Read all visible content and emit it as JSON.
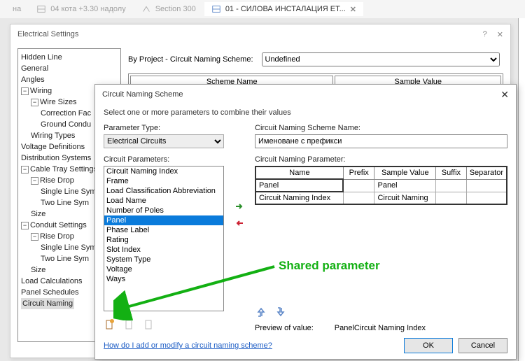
{
  "doc_tabs": {
    "t0_label": "на",
    "t1_label": "04 кота +3.30 надолу",
    "t2_label": "Section 300",
    "t3_label": "01 - СИЛОВА ИНСТАЛАЦИЯ ЕТ..."
  },
  "dlg1": {
    "title": "Electrical Settings",
    "help_glyph": "?",
    "close_glyph": "✕",
    "byproj_label": "By Project - Circuit Naming Scheme:",
    "byproj_value": "Undefined",
    "col_scheme": "Scheme Name",
    "col_sample": "Sample Value",
    "tree": {
      "hidden_line": "Hidden Line",
      "general": "General",
      "angles": "Angles",
      "wiring": "Wiring",
      "wire_sizes": "Wire Sizes",
      "correction_factor": "Correction Fac",
      "ground_conductors": "Ground Condu",
      "wiring_types": "Wiring Types",
      "voltage_defs": "Voltage Definitions",
      "dist_systems": "Distribution Systems",
      "cable_tray": "Cable Tray Settings",
      "rise_drop": "Rise Drop",
      "single_line": "Single Line Sym",
      "two_line": "Two Line Sym",
      "size": "Size",
      "conduit": "Conduit Settings",
      "load_calc": "Load Calculations",
      "panel_sched": "Panel Schedules",
      "circuit_naming": "Circuit Naming"
    }
  },
  "dlg2": {
    "title": "Circuit Naming Scheme",
    "subtitle": "Select one or more parameters to combine their values",
    "param_type_label": "Parameter Type:",
    "param_type_value": "Electrical Circuits",
    "circuit_params_label": "Circuit Parameters:",
    "scheme_name_label": "Circuit Naming Scheme Name:",
    "scheme_name_value": "Именоване с префикси",
    "naming_param_label": "Circuit Naming Parameter:",
    "cols": {
      "name": "Name",
      "prefix": "Prefix",
      "sample": "Sample Value",
      "suffix": "Suffix",
      "sep": "Separator"
    },
    "rows": {
      "r0_name": "Panel",
      "r0_sample": "Panel",
      "r1_name": "Circuit Naming Index",
      "r1_sample": "Circuit Naming"
    },
    "params": {
      "p0": "Circuit Naming Index",
      "p1": "Frame",
      "p2": "Load Classification Abbreviation",
      "p3": "Load Name",
      "p4": "Number of Poles",
      "p5": "Panel",
      "p6": "Phase Label",
      "p7": "Rating",
      "p8": "Slot Index",
      "p9": "System Type",
      "p10": "Voltage",
      "p11": "Ways"
    },
    "preview_label": "Preview of value:",
    "preview_value": "PanelCircuit Naming Index",
    "help_link": "How do I add or modify a circuit naming scheme?",
    "ok": "OK",
    "cancel": "Cancel"
  },
  "annotation": {
    "text": "Shared parameter"
  }
}
